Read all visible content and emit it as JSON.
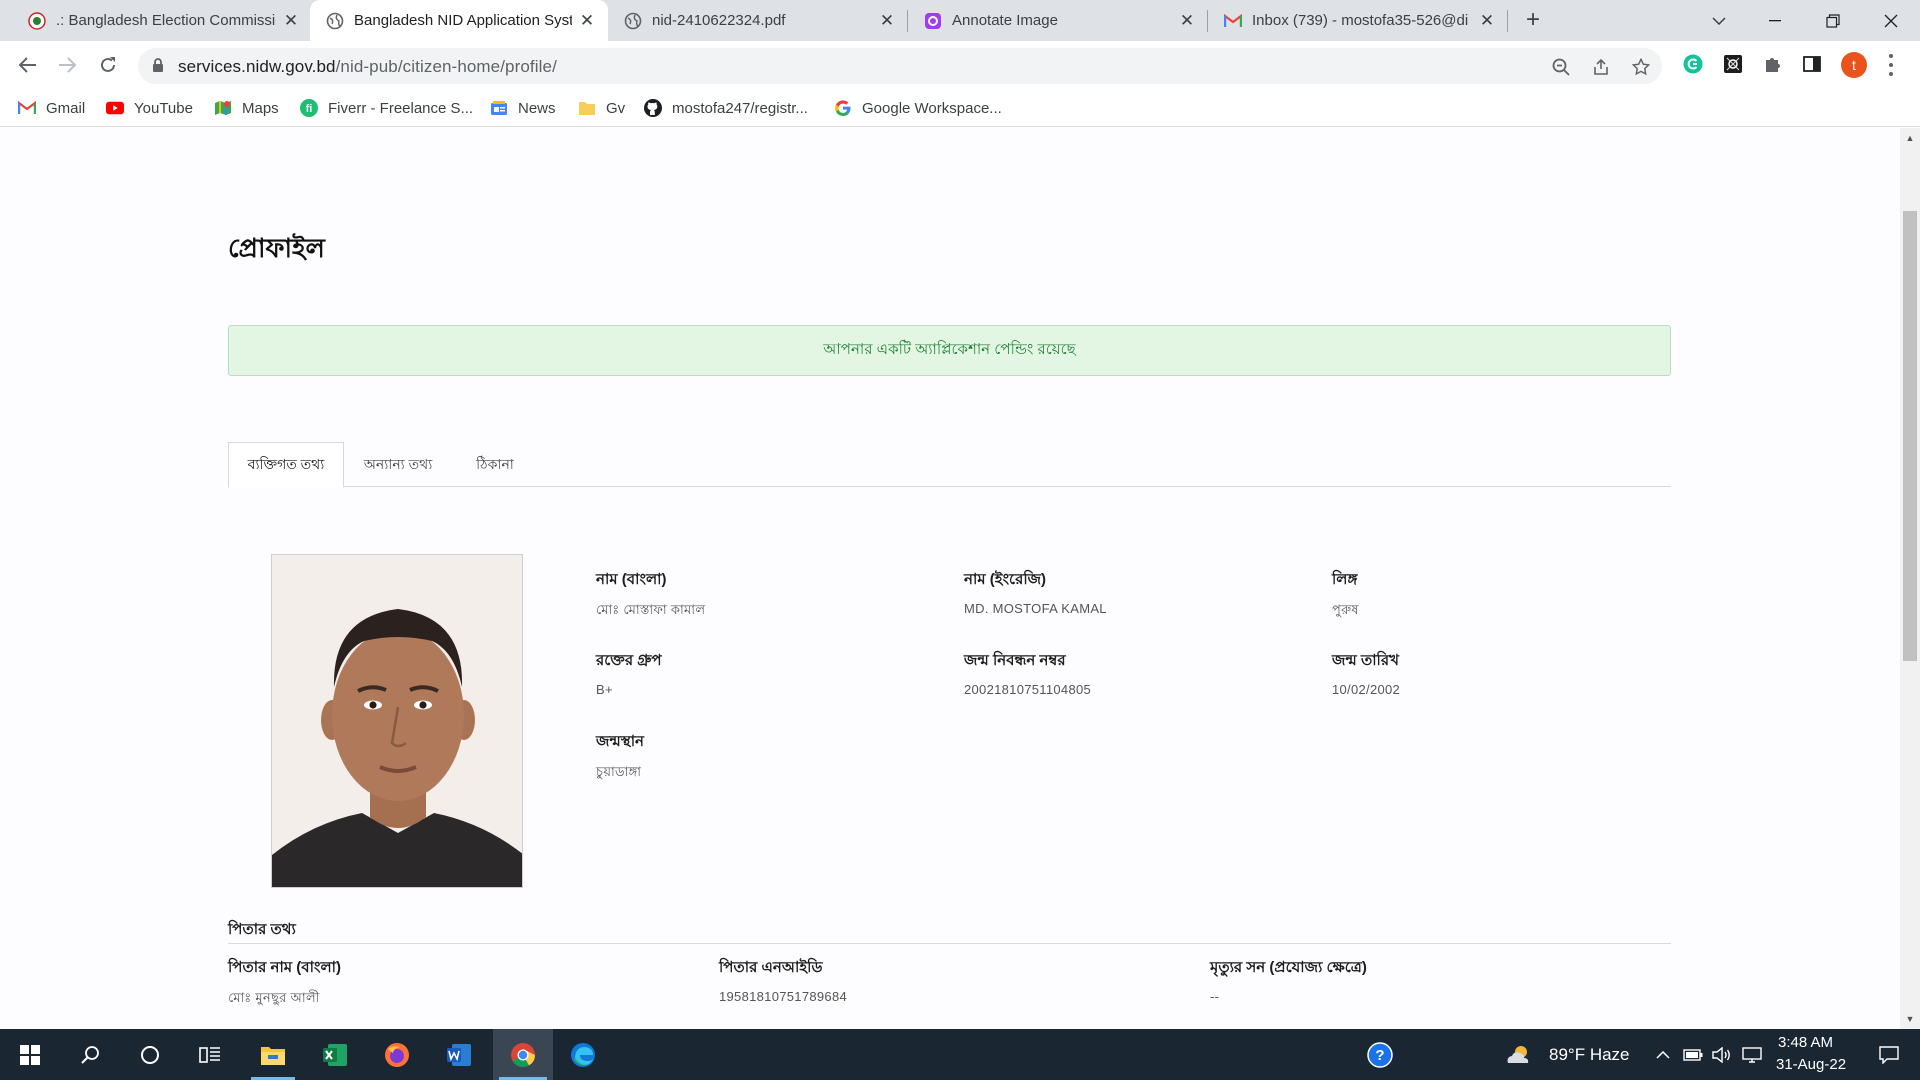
{
  "browser": {
    "tabs": [
      {
        "title": ".: Bangladesh Election Commissio",
        "active": false
      },
      {
        "title": "Bangladesh NID Application Syst",
        "active": true
      },
      {
        "title": "nid-2410622324.pdf",
        "active": false
      },
      {
        "title": "Annotate Image",
        "active": false
      },
      {
        "title": "Inbox (739) - mostofa35-526@di",
        "active": false
      }
    ],
    "new_tab": "+",
    "url_host": "services.nidw.gov.bd",
    "url_path": "/nid-pub/citizen-home/profile/",
    "profile_initial": "t",
    "bookmarks": [
      {
        "label": "Gmail",
        "icon": "gmail-icon"
      },
      {
        "label": "YouTube",
        "icon": "youtube-icon"
      },
      {
        "label": "Maps",
        "icon": "maps-icon"
      },
      {
        "label": "Fiverr - Freelance S...",
        "icon": "fiverr-icon"
      },
      {
        "label": "News",
        "icon": "news-icon"
      },
      {
        "label": "Gv",
        "icon": "folder-icon"
      },
      {
        "label": "mostofa247/registr...",
        "icon": "github-icon"
      },
      {
        "label": "Google Workspace...",
        "icon": "google-icon"
      }
    ]
  },
  "page": {
    "title": "প্রোফাইল",
    "alert": "আপনার একটি অ্যাপ্লিকেশান পেন্ডিং রয়েছে",
    "tabs": [
      {
        "label": "ব্যক্তিগত তথ্য",
        "active": true
      },
      {
        "label": "অন্যান্য তথ্য",
        "active": false
      },
      {
        "label": "ঠিকানা",
        "active": false
      }
    ],
    "personal": {
      "name_bn_label": "নাম (বাংলা)",
      "name_bn": "মোঃ মোস্তাফা কামাল",
      "name_en_label": "নাম (ইংরেজি)",
      "name_en": "MD. MOSTOFA KAMAL",
      "gender_label": "লিঙ্গ",
      "gender": "পুরুষ",
      "blood_label": "রক্তের গ্রুপ",
      "blood": "B+",
      "birth_reg_label": "জন্ম নিবন্ধন নম্বর",
      "birth_reg": "20021810751104805",
      "dob_label": "জন্ম তারিখ",
      "dob": "10/02/2002",
      "birthplace_label": "জন্মস্থান",
      "birthplace": "চুয়াডাঙ্গা"
    },
    "father": {
      "section_title": "পিতার তথ্য",
      "name_bn_label": "পিতার নাম (বাংলা)",
      "name_bn": "মোঃ মুনছুর আলী",
      "nid_label": "পিতার এনআইডি",
      "nid": "19581810751789684",
      "death_label": "মৃত্যুর সন (প্রযোজ্য ক্ষেত্রে)",
      "death": "--"
    }
  },
  "taskbar": {
    "weather": "89°F  Haze",
    "time": "3:48 AM",
    "date": "31-Aug-22"
  },
  "colors": {
    "alert_bg": "#e3f6e4",
    "alert_text": "#1e7e34",
    "taskbar_bg": "#1b2633",
    "profile_avatar": "#e8541c"
  }
}
